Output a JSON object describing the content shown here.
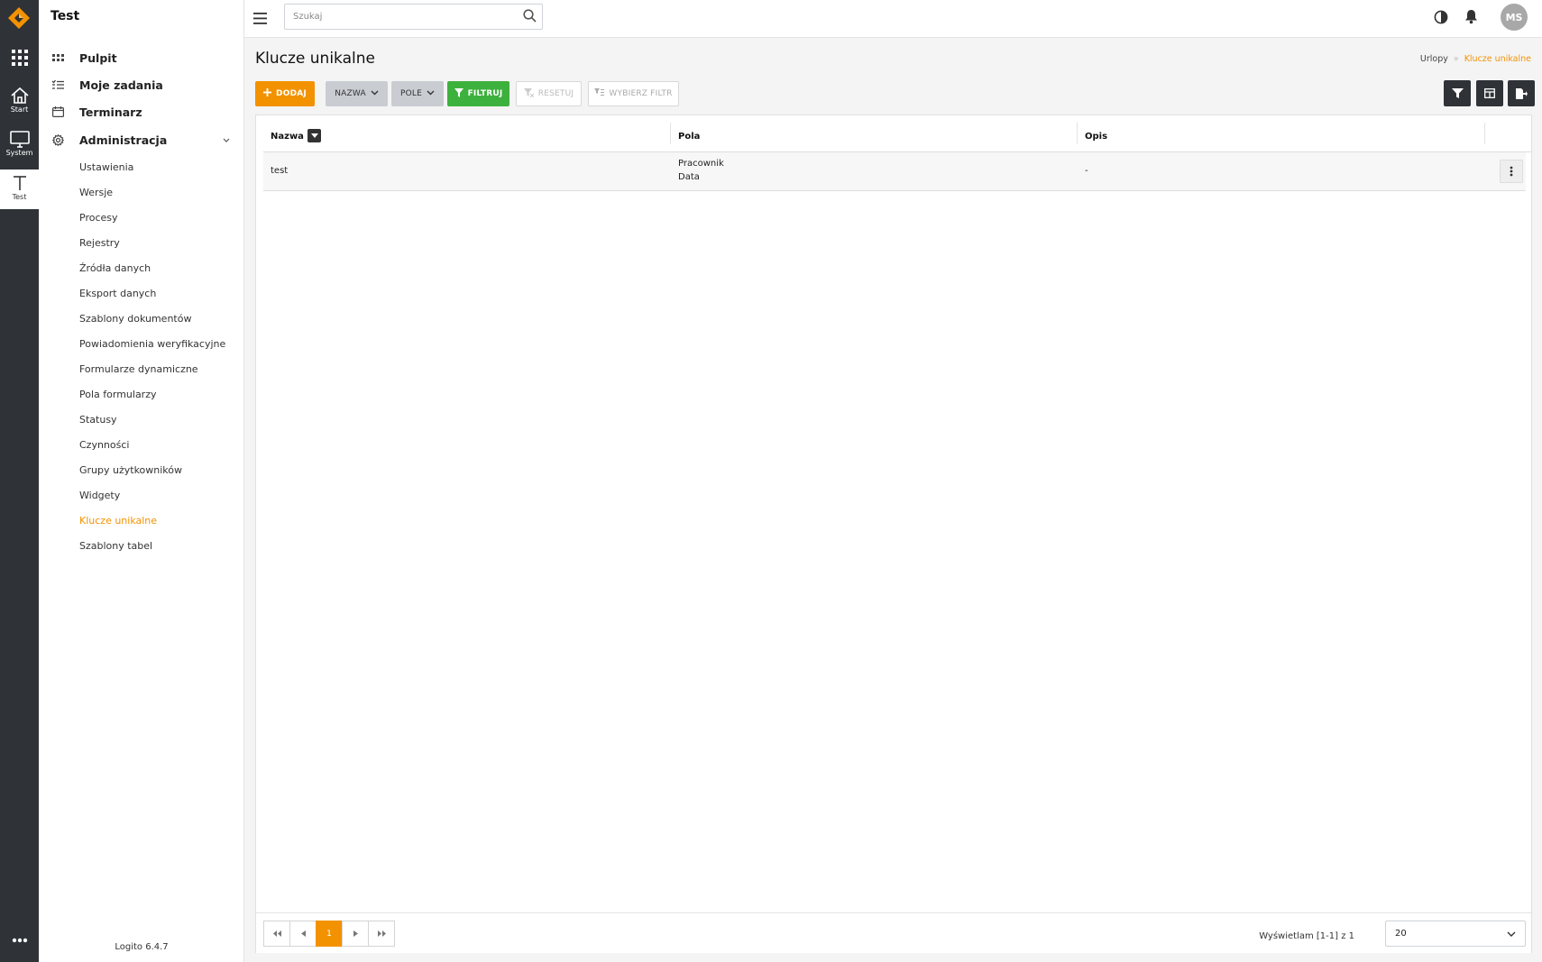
{
  "rail": {
    "items": [
      {
        "label": "Start",
        "icon": "home-icon"
      },
      {
        "label": "System",
        "icon": "monitor-icon"
      },
      {
        "label": "Test",
        "icon": "text-icon",
        "active": true
      }
    ]
  },
  "sidebar": {
    "title": "Test",
    "menu": [
      {
        "label": "Pulpit",
        "icon": "dashboard-icon"
      },
      {
        "label": "Moje zadania",
        "icon": "tasks-icon"
      },
      {
        "label": "Terminarz",
        "icon": "calendar-icon"
      },
      {
        "label": "Administracja",
        "icon": "gear-icon",
        "expanded": true
      }
    ],
    "submenu": [
      "Ustawienia",
      "Wersje",
      "Procesy",
      "Rejestry",
      "Źródła danych",
      "Eksport danych",
      "Szablony dokumentów",
      "Powiadomienia weryfikacyjne",
      "Formularze dynamiczne",
      "Pola formularzy",
      "Statusy",
      "Czynności",
      "Grupy użytkowników",
      "Widgety",
      "Klucze unikalne",
      "Szablony tabel"
    ],
    "active_submenu": "Klucze unikalne",
    "version": "Logito 6.4.7"
  },
  "topbar": {
    "search_placeholder": "Szukaj",
    "avatar_initials": "MS"
  },
  "page": {
    "title": "Klucze unikalne",
    "breadcrumb": [
      "Urlopy",
      "Klucze unikalne"
    ]
  },
  "toolbar": {
    "add_label": "DODAJ",
    "name_dropdown": "NAZWA",
    "field_dropdown": "POLE",
    "filter_label": "FILTRUJ",
    "reset_label": "RESETUJ",
    "choose_filter_label": "WYBIERZ FILTR"
  },
  "table": {
    "columns": [
      "Nazwa",
      "Pola",
      "Opis"
    ],
    "rows": [
      {
        "nazwa": "test",
        "pola": [
          "Pracownik",
          "Data"
        ],
        "opis": "-"
      }
    ]
  },
  "pagination": {
    "current_page": "1",
    "showing": "Wyświetlam [1-1] z 1",
    "per_page": "20"
  },
  "colors": {
    "accent": "#f39200",
    "filter_green": "#3db13d",
    "rail": "#2f3237"
  }
}
